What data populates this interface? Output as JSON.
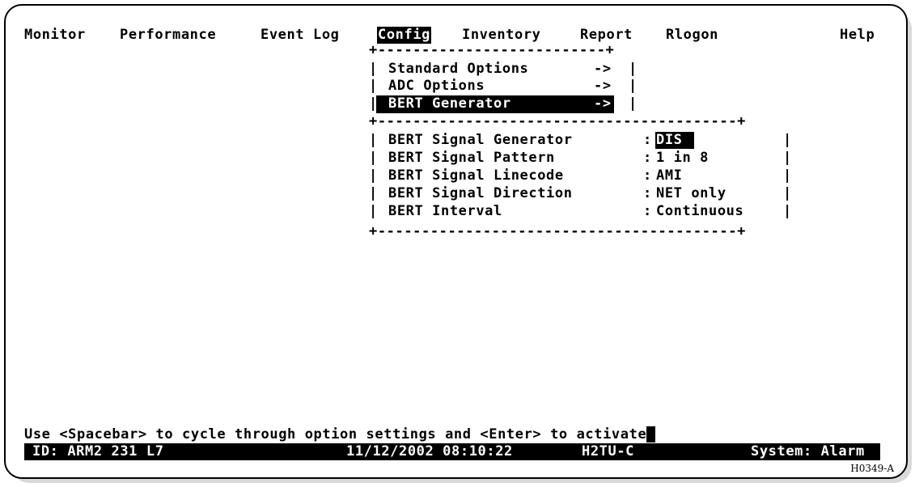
{
  "menubar": {
    "items": [
      "Monitor",
      "Performance",
      "Event Log",
      "Config",
      "Inventory",
      "Report",
      "Rlogon"
    ],
    "help": "Help",
    "selected": "Config"
  },
  "config_menu": {
    "items": [
      {
        "label": "Standard Options",
        "arrow": "->"
      },
      {
        "label": "ADC Options",
        "arrow": "->"
      },
      {
        "label": "BERT Generator",
        "arrow": "->"
      }
    ],
    "selected_index": 2
  },
  "bert_panel": {
    "rows": [
      {
        "label": "BERT Signal Generator",
        "value": "DIS"
      },
      {
        "label": "BERT Signal Pattern",
        "value": "1 in 8"
      },
      {
        "label": "BERT Signal Linecode",
        "value": "AMI"
      },
      {
        "label": "BERT Signal Direction",
        "value": "NET only"
      },
      {
        "label": "BERT Interval",
        "value": "Continuous"
      }
    ],
    "selected_value_index": 0
  },
  "status": {
    "hint": "Use <Spacebar> to cycle through option settings and <Enter> to activate",
    "id": "ID: ARM2 231 L7",
    "datetime": "11/12/2002 08:10:22",
    "unit": "H2TU-C",
    "system": "System: Alarm"
  },
  "figure_code": "H0349-A",
  "colors": {
    "foreground": "#000000",
    "background": "#ffffff",
    "highlight_bg": "#000000",
    "highlight_fg": "#ffffff"
  }
}
